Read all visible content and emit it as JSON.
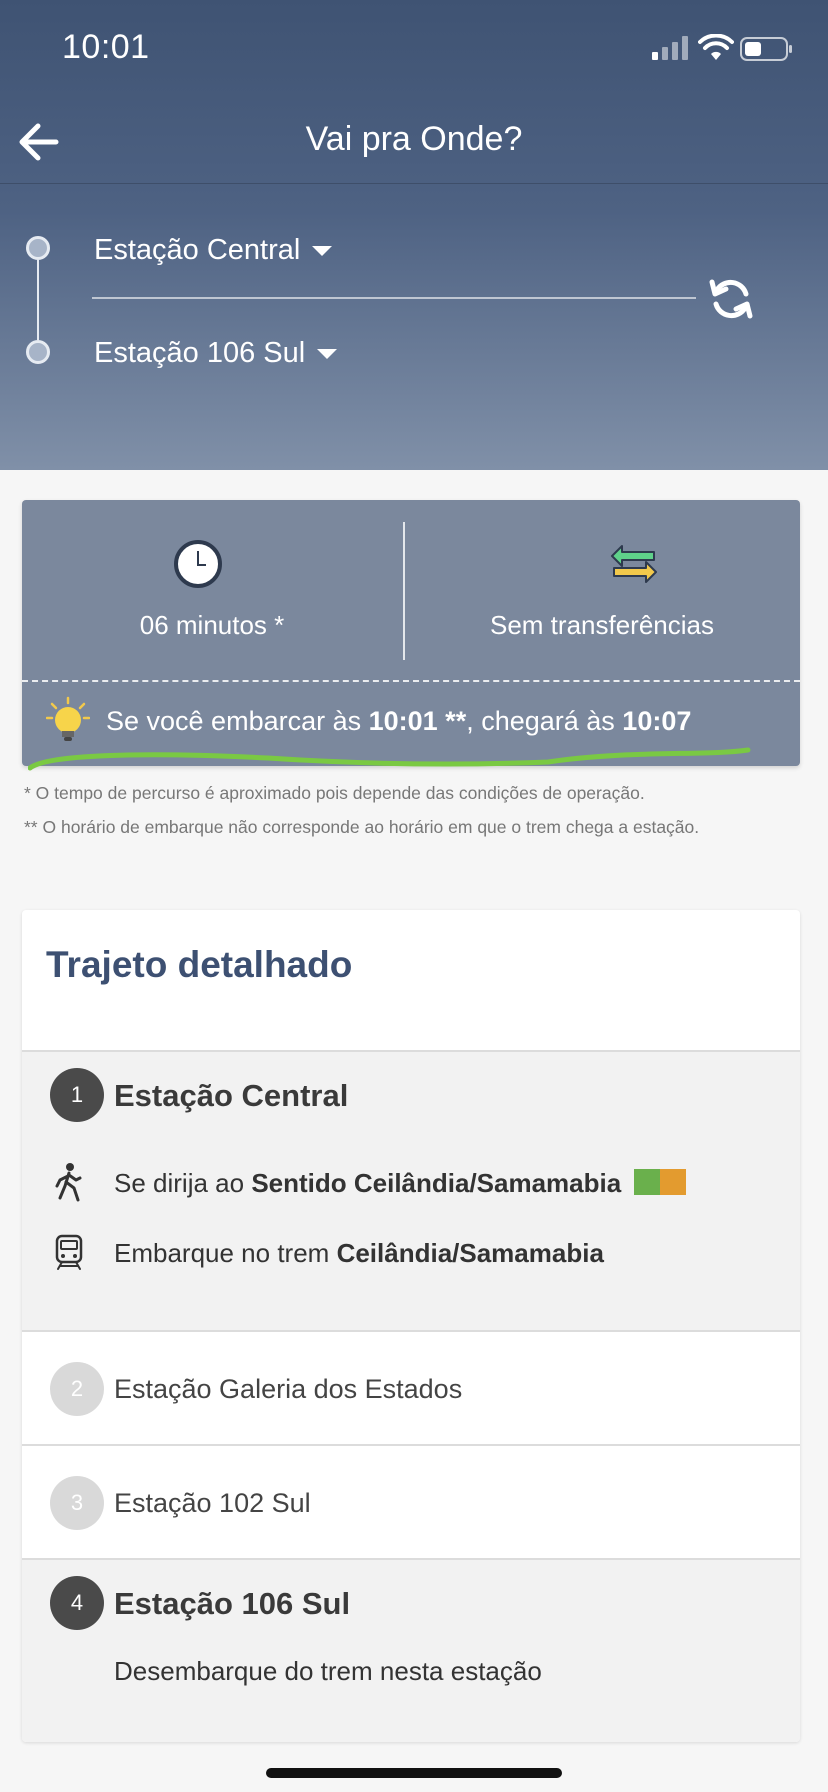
{
  "status": {
    "time": "10:01"
  },
  "nav": {
    "title": "Vai pra Onde?"
  },
  "route": {
    "from": "Estação Central",
    "to": "Estação 106 Sul"
  },
  "summary": {
    "duration": "06 minutos *",
    "transfers": "Sem transferências",
    "embark_prefix": "Se você embarcar às ",
    "embark_time": "10:01 **",
    "embark_mid": ", chegará às ",
    "arrival_time": "10:07"
  },
  "notes": [
    "* O tempo de percurso é aproximado pois depende das condições de operação.",
    "** O horário de embarque não corresponde ao horário em que o trem chega a estação."
  ],
  "detail": {
    "title": "Trajeto detalhado",
    "steps": [
      {
        "number": "1",
        "name": "Estação Central",
        "walk_prefix": "Se dirija ao ",
        "walk_bold": "Sentido Ceilândia/Samamabia",
        "board_prefix": "Embarque no trem ",
        "board_bold": "Ceilândia/Samamabia"
      },
      {
        "number": "2",
        "name": "Estação Galeria dos Estados"
      },
      {
        "number": "3",
        "name": "Estação 102 Sul"
      },
      {
        "number": "4",
        "name": "Estação 106 Sul",
        "instruction": "Desembarque do trem nesta estação"
      }
    ]
  },
  "colors": {
    "line_green": "#6ab04c",
    "line_orange": "#e39b2f",
    "header": "#3f5373",
    "highlight": "#7ac943"
  },
  "icons": [
    "back-arrow-icon",
    "swap-icon",
    "clock-icon",
    "transfer-icon",
    "lightbulb-icon",
    "walk-icon",
    "train-icon"
  ]
}
